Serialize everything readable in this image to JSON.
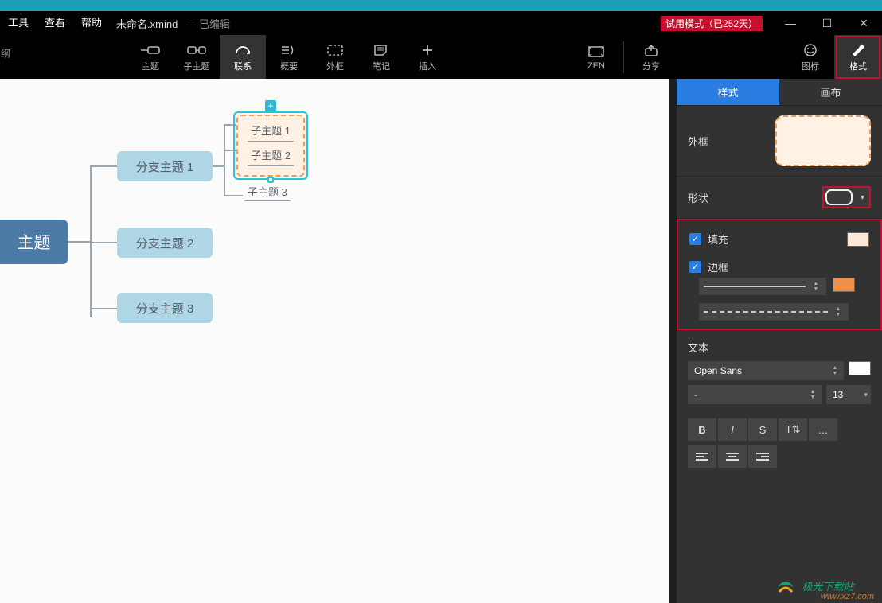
{
  "menubar": {
    "tools": "工具",
    "view": "查看",
    "help": "帮助"
  },
  "file": {
    "name": "未命名.xmind",
    "state": "— 已编辑"
  },
  "trial_label": "试用模式（已252天）",
  "toolbar": {
    "topic": "主题",
    "subtopic": "子主题",
    "relation": "联系",
    "summary": "概要",
    "boundary": "外框",
    "note": "笔记",
    "insert": "插入",
    "zen": "ZEN",
    "share": "分享",
    "icons": "图标",
    "format": "格式"
  },
  "mindmap": {
    "central": "主题",
    "branches": [
      "分支主题 1",
      "分支主题 2",
      "分支主题 3"
    ],
    "subs": [
      "子主题 1",
      "子主题 2",
      "子主题 3"
    ]
  },
  "panel": {
    "tab_style": "样式",
    "tab_canvas": "画布",
    "boundary_label": "外框",
    "shape_label": "形状",
    "fill_label": "填充",
    "border_label": "边框",
    "text_label": "文本",
    "font_family": "Open Sans",
    "font_weight_placeholder": "-",
    "font_size": "13",
    "colors": {
      "fill": "#fce9d8",
      "border": "#f19149",
      "text": "#ffffff"
    }
  },
  "watermark": {
    "brand": "极光下载站",
    "url": "www.xz7.com"
  }
}
